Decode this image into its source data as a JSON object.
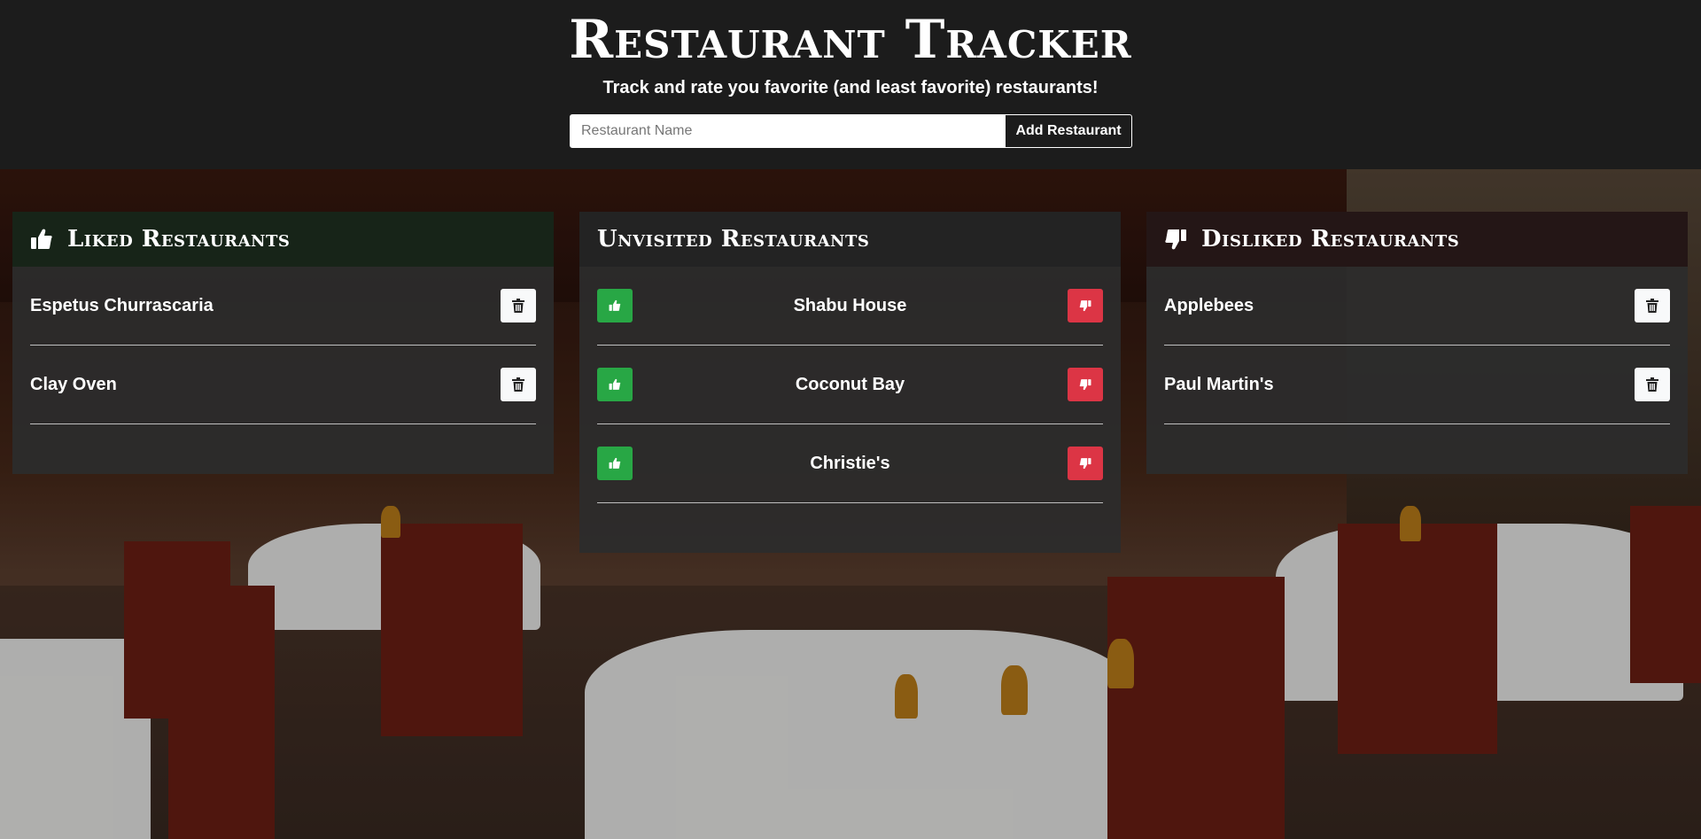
{
  "header": {
    "title": "Restaurant Tracker",
    "subtitle": "Track and rate you favorite (and least favorite) restaurants!",
    "input_placeholder": "Restaurant Name",
    "add_button_label": "Add Restaurant"
  },
  "panels": {
    "liked": {
      "title": "Liked Restaurants",
      "icon": "thumbs-up-icon",
      "items": [
        {
          "name": "Espetus Churrascaria"
        },
        {
          "name": "Clay Oven"
        }
      ]
    },
    "unvisited": {
      "title": "Unvisited Restaurants",
      "items": [
        {
          "name": "Shabu House"
        },
        {
          "name": "Coconut Bay"
        },
        {
          "name": "Christie's"
        }
      ]
    },
    "disliked": {
      "title": "Disliked Restaurants",
      "icon": "thumbs-down-icon",
      "items": [
        {
          "name": "Applebees"
        },
        {
          "name": "Paul Martin's"
        }
      ]
    }
  },
  "colors": {
    "like": "#28a745",
    "dislike": "#dc3545",
    "header_bg": "#1c1c1c"
  }
}
